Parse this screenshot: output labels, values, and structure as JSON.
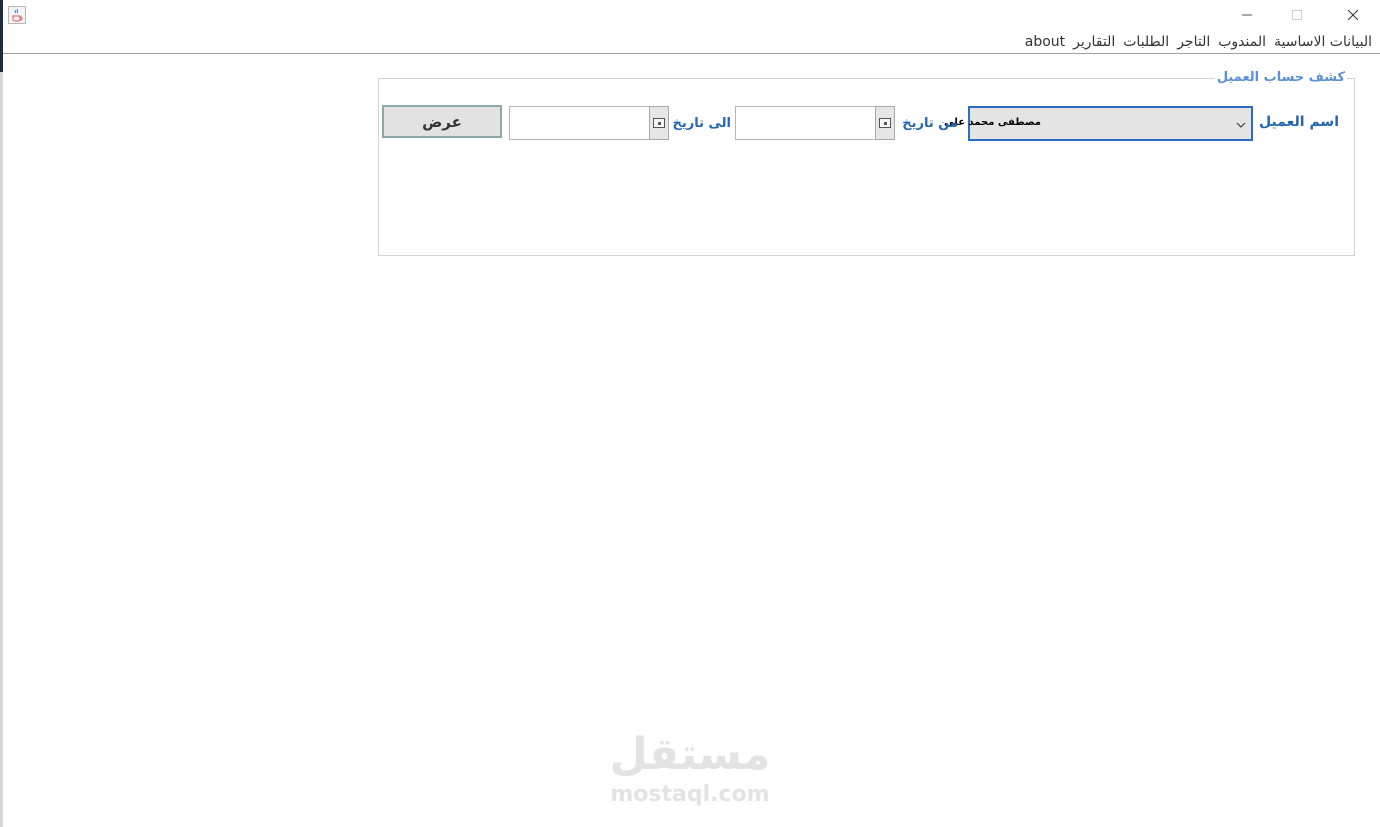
{
  "window": {
    "icon": "java-coffee-icon",
    "controls": [
      "minimize-icon",
      "maximize-icon",
      "close-icon"
    ]
  },
  "menu": {
    "items": [
      "البيانات الاساسية",
      "المندوب",
      "التاجر",
      "الطلبات",
      "التقارير",
      "about"
    ]
  },
  "panel": {
    "title": "كشف حساب العميل",
    "customer_label": "اسم العميل",
    "customer_value": "مصطفى محمد على",
    "from_date_label": "من تاريخ",
    "from_date_value": "",
    "to_date_label": "الى تاريخ",
    "to_date_value": "",
    "show_button": "عرض"
  },
  "watermark": {
    "arabic": "مستقل",
    "latin": "mostaql.com"
  },
  "colors": {
    "label_blue": "#2466b4",
    "panel_title_blue": "#5b8fd6",
    "combo_border": "#2b6cc4"
  }
}
